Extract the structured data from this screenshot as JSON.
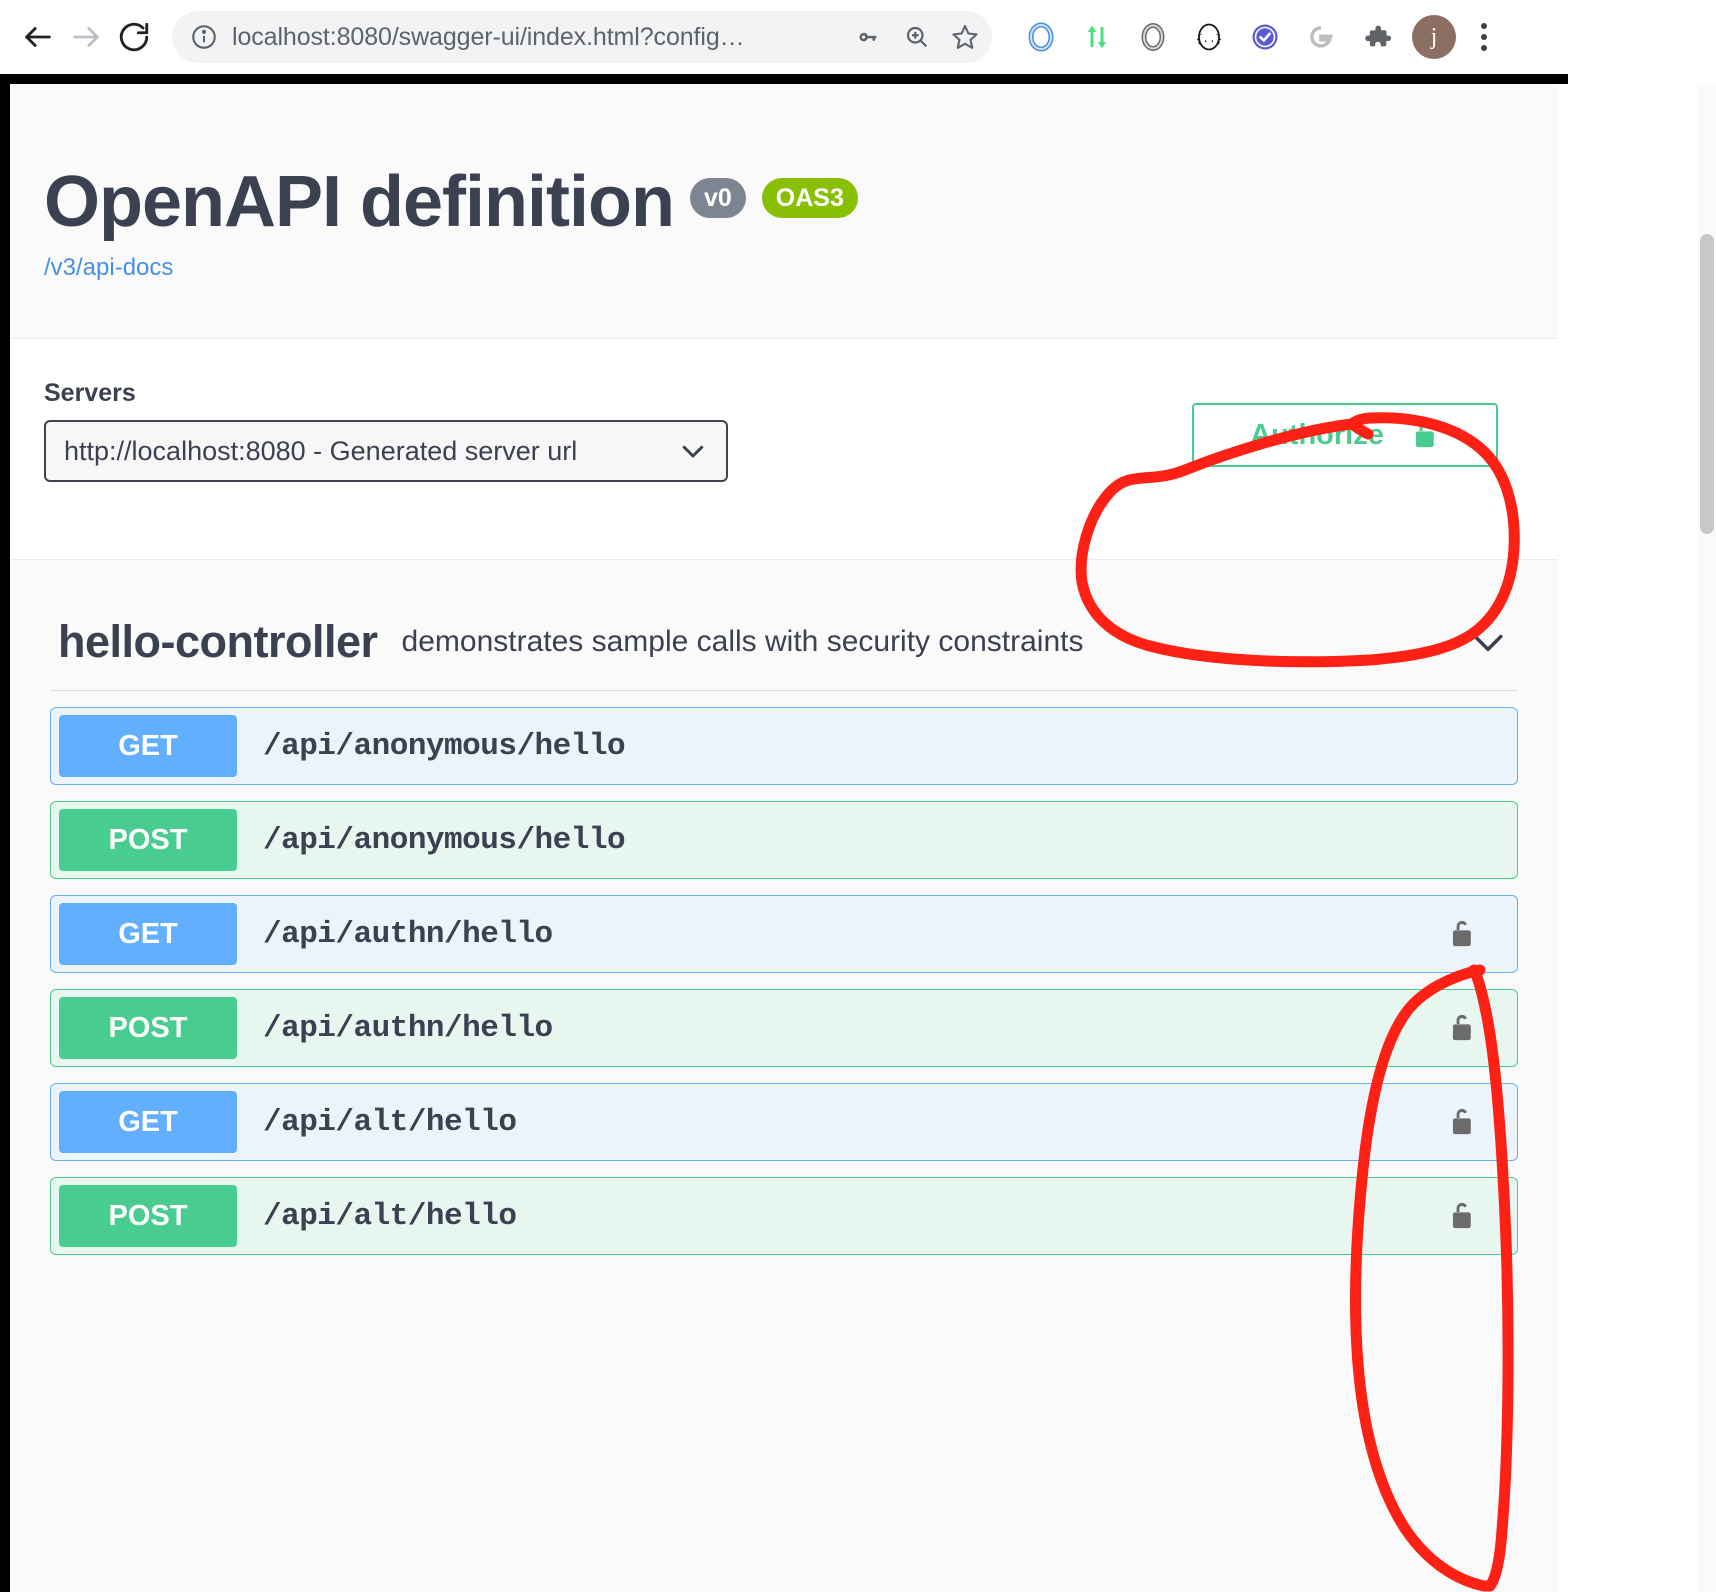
{
  "browser": {
    "back_icon": "arrow-left-icon",
    "forward_icon": "arrow-right-icon",
    "reload_icon": "reload-icon",
    "site_info_icon": "info-circle-icon",
    "url_display": "localhost:8080/swagger-ui/index.html?config…",
    "url_host": "localhost:8080",
    "url_path": "/swagger-ui/index.html?config…",
    "omnibox_icons": [
      "key-icon",
      "zoom-in-icon",
      "star-icon"
    ],
    "extension_icons": [
      "blue-ring-extension-icon",
      "green-arrows-extension-icon",
      "gray-ring-extension-icon",
      "braces-extension-icon",
      "purple-check-extension-icon",
      "google-g-extension-icon",
      "puzzle-extensions-icon"
    ],
    "avatar_initial": "j",
    "menu_icon": "kebab-menu-icon"
  },
  "info": {
    "title": "OpenAPI definition",
    "version_badge": "v0",
    "oas_badge": "OAS3",
    "docs_link": "/v3/api-docs"
  },
  "servers": {
    "label": "Servers",
    "selected": "http://localhost:8080 - Generated server url",
    "options": [
      "http://localhost:8080 - Generated server url"
    ],
    "chevron_icon": "chevron-down-icon"
  },
  "authorize": {
    "label": "Authorize",
    "lock_icon": "unlocked-padlock-icon",
    "color": "#49cc90"
  },
  "tag": {
    "name": "hello-controller",
    "description": "demonstrates sample calls with security constraints",
    "toggle_icon": "chevron-down-icon"
  },
  "operations": [
    {
      "method": "GET",
      "path": "/api/anonymous/hello",
      "locked": false,
      "color": "#61affe"
    },
    {
      "method": "POST",
      "path": "/api/anonymous/hello",
      "locked": false,
      "color": "#49cc90"
    },
    {
      "method": "GET",
      "path": "/api/authn/hello",
      "locked": true,
      "color": "#61affe"
    },
    {
      "method": "POST",
      "path": "/api/authn/hello",
      "locked": true,
      "color": "#49cc90"
    },
    {
      "method": "GET",
      "path": "/api/alt/hello",
      "locked": true,
      "color": "#61affe"
    },
    {
      "method": "POST",
      "path": "/api/alt/hello",
      "locked": true,
      "color": "#49cc90"
    }
  ],
  "annotations": {
    "color": "#fc2015",
    "shapes": [
      "circle-around-authorize-button",
      "ellipse-around-operation-lock-icons"
    ]
  }
}
